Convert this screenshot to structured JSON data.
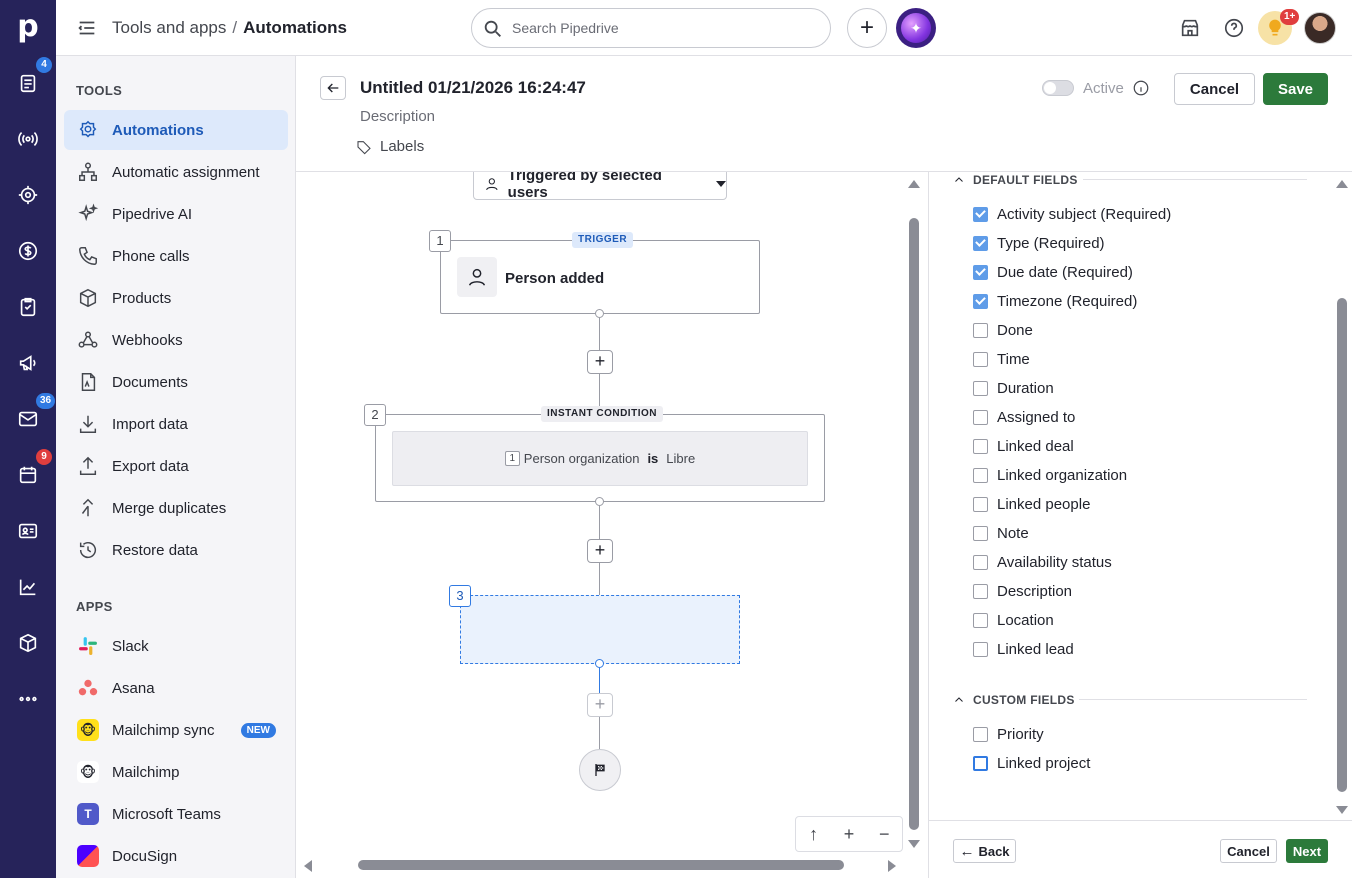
{
  "rail": {
    "logo": "p",
    "badges": {
      "leads": "4",
      "mail": "36",
      "activities": "9"
    }
  },
  "topbar": {
    "breadcrumb_parent": "Tools and apps",
    "breadcrumb_sep": "/",
    "breadcrumb_current": "Automations",
    "search_placeholder": "Search Pipedrive",
    "add_label": "+",
    "notif_badge": "1+"
  },
  "sidebar": {
    "tools_heading": "TOOLS",
    "tools": [
      {
        "label": "Automations",
        "icon": "automation-icon"
      },
      {
        "label": "Automatic assignment",
        "icon": "assignment-icon"
      },
      {
        "label": "Pipedrive AI",
        "icon": "sparkles-icon"
      },
      {
        "label": "Phone calls",
        "icon": "phone-icon"
      },
      {
        "label": "Products",
        "icon": "box-icon"
      },
      {
        "label": "Webhooks",
        "icon": "webhook-icon"
      },
      {
        "label": "Documents",
        "icon": "document-icon"
      },
      {
        "label": "Import data",
        "icon": "download-icon"
      },
      {
        "label": "Export data",
        "icon": "upload-icon"
      },
      {
        "label": "Merge duplicates",
        "icon": "merge-icon"
      },
      {
        "label": "Restore data",
        "icon": "restore-icon"
      }
    ],
    "apps_heading": "APPS",
    "apps": [
      {
        "label": "Slack",
        "icon": "slack-icon"
      },
      {
        "label": "Asana",
        "icon": "asana-icon"
      },
      {
        "label": "Mailchimp sync",
        "icon": "mailchimp-icon",
        "badge": "NEW"
      },
      {
        "label": "Mailchimp",
        "icon": "mailchimp-icon"
      },
      {
        "label": "Microsoft Teams",
        "icon": "teams-icon"
      },
      {
        "label": "DocuSign",
        "icon": "docusign-icon"
      }
    ]
  },
  "header": {
    "title": "Untitled 01/21/2026 16:24:47",
    "description": "Description",
    "labels": "Labels",
    "active_label": "Active",
    "cancel_label": "Cancel",
    "save_label": "Save"
  },
  "canvas": {
    "trigger_selector": "Triggered by selected users",
    "step1": {
      "num": "1",
      "tag": "TRIGGER",
      "label": "Person added"
    },
    "step2": {
      "num": "2",
      "tag": "INSTANT CONDITION",
      "cond_num": "1",
      "field": "Person organization",
      "op": "is",
      "value": "Libre"
    },
    "step3": {
      "num": "3"
    },
    "zoom": {
      "up": "↑",
      "plus": "+",
      "minus": "−"
    }
  },
  "panel": {
    "default_heading": "DEFAULT FIELDS",
    "default_fields": [
      {
        "label": "Activity subject (Required)",
        "checked": true
      },
      {
        "label": "Type (Required)",
        "checked": true
      },
      {
        "label": "Due date (Required)",
        "checked": true
      },
      {
        "label": "Timezone (Required)",
        "checked": true
      },
      {
        "label": "Done",
        "checked": false
      },
      {
        "label": "Time",
        "checked": false
      },
      {
        "label": "Duration",
        "checked": false
      },
      {
        "label": "Assigned to",
        "checked": false
      },
      {
        "label": "Linked deal",
        "checked": false
      },
      {
        "label": "Linked organization",
        "checked": false
      },
      {
        "label": "Linked people",
        "checked": false
      },
      {
        "label": "Note",
        "checked": false
      },
      {
        "label": "Availability status",
        "checked": false
      },
      {
        "label": "Description",
        "checked": false
      },
      {
        "label": "Location",
        "checked": false
      },
      {
        "label": "Linked lead",
        "checked": false
      }
    ],
    "custom_heading": "CUSTOM FIELDS",
    "custom_fields": [
      {
        "label": "Priority",
        "checked": false
      },
      {
        "label": "Linked project",
        "checked": false
      }
    ],
    "back_label": "Back",
    "cancel_label": "Cancel",
    "next_label": "Next"
  },
  "colors": {
    "rail": "#26235a",
    "accent": "#317ae2",
    "primary_button": "#2c7a3b",
    "active_item_bg": "#dde9fb"
  }
}
